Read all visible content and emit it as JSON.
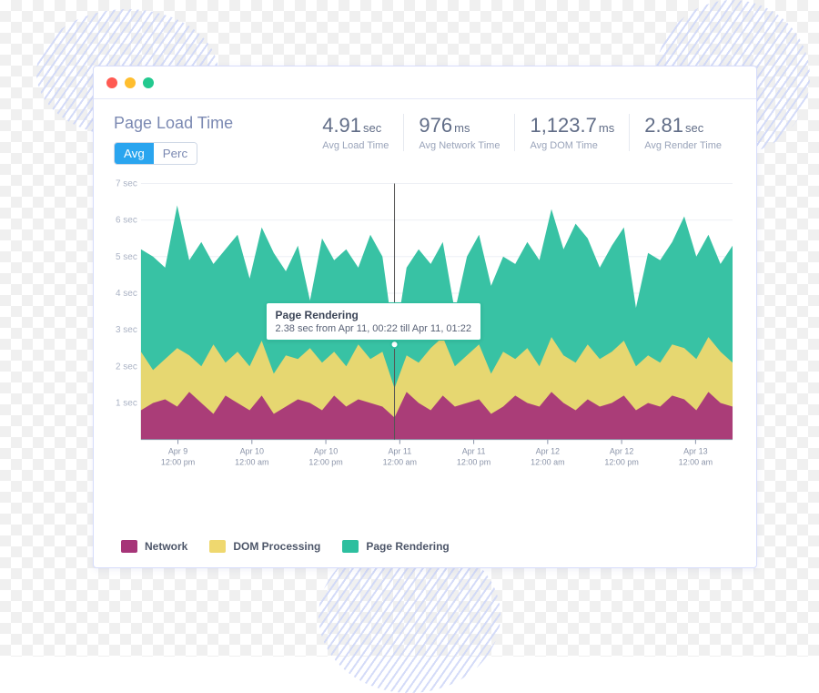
{
  "window": {
    "title": "Page Load Time"
  },
  "toggle": {
    "avg": "Avg",
    "perc": "Perc"
  },
  "metrics": [
    {
      "value": "4.91",
      "unit": "sec",
      "label": "Avg Load Time"
    },
    {
      "value": "976",
      "unit": "ms",
      "label": "Avg Network Time"
    },
    {
      "value": "1,123.7",
      "unit": "ms",
      "label": "Avg DOM Time"
    },
    {
      "value": "2.81",
      "unit": "sec",
      "label": "Avg Render Time"
    }
  ],
  "tooltip": {
    "title": "Page Rendering",
    "body": "2.38 sec from Apr 11, 00:22 till Apr 11, 01:22"
  },
  "legend": [
    {
      "name": "Network",
      "color": "#a63578"
    },
    {
      "name": "DOM Processing",
      "color": "#efd86f"
    },
    {
      "name": "Page Rendering",
      "color": "#2dbf9f"
    }
  ],
  "chart_data": {
    "type": "area",
    "title": "Page Load Time",
    "ylabel": "",
    "xlabel": "",
    "ylim": [
      0,
      7
    ],
    "y_ticks": [
      "1 sec",
      "2 sec",
      "3 sec",
      "4 sec",
      "5 sec",
      "6 sec",
      "7 sec"
    ],
    "x_ticks": [
      "Apr 9\n12:00 pm",
      "Apr 10\n12:00 am",
      "Apr 10\n12:00 pm",
      "Apr 11\n12:00 am",
      "Apr 11\n12:00 pm",
      "Apr 12\n12:00 am",
      "Apr 12\n12:00 pm",
      "Apr 13\n12:00 am"
    ],
    "series": [
      {
        "name": "Network",
        "color": "#a63578",
        "values": [
          0.8,
          1.0,
          1.1,
          0.9,
          1.3,
          1.0,
          0.7,
          1.2,
          1.0,
          0.8,
          1.2,
          0.7,
          0.9,
          1.1,
          1.0,
          0.8,
          1.2,
          0.9,
          1.1,
          1.0,
          0.9,
          0.6,
          1.3,
          1.0,
          0.8,
          1.2,
          0.9,
          1.0,
          1.1,
          0.7,
          0.9,
          1.2,
          1.0,
          0.9,
          1.3,
          1.0,
          0.8,
          1.1,
          0.9,
          1.0,
          1.2,
          0.8,
          1.0,
          0.9,
          1.2,
          1.1,
          0.8,
          1.3,
          1.0,
          0.9
        ]
      },
      {
        "name": "DOM Processing",
        "color": "#efd86f",
        "values": [
          2.4,
          1.9,
          2.2,
          2.5,
          2.3,
          2.0,
          2.6,
          2.1,
          2.4,
          2.0,
          2.7,
          1.8,
          2.3,
          2.2,
          2.5,
          2.1,
          2.4,
          2.0,
          2.6,
          2.2,
          2.4,
          1.4,
          2.3,
          2.1,
          2.5,
          2.8,
          2.0,
          2.3,
          2.6,
          1.8,
          2.4,
          2.2,
          2.5,
          2.0,
          2.8,
          2.3,
          2.1,
          2.6,
          2.2,
          2.4,
          2.7,
          2.0,
          2.3,
          2.1,
          2.6,
          2.5,
          2.2,
          2.8,
          2.4,
          2.1
        ]
      },
      {
        "name": "Page Rendering",
        "color": "#2dbf9f",
        "values": [
          5.2,
          5.0,
          4.7,
          6.4,
          4.9,
          5.4,
          4.8,
          5.2,
          5.6,
          4.4,
          5.8,
          5.1,
          4.6,
          5.3,
          3.8,
          5.5,
          4.9,
          5.2,
          4.7,
          5.6,
          5.0,
          2.6,
          4.7,
          5.2,
          4.8,
          5.4,
          3.5,
          5.0,
          5.6,
          4.2,
          5.0,
          4.8,
          5.4,
          4.9,
          6.3,
          5.2,
          5.9,
          5.5,
          4.7,
          5.3,
          5.8,
          3.6,
          5.1,
          4.9,
          5.4,
          6.1,
          5.0,
          5.6,
          4.8,
          5.3
        ]
      }
    ],
    "crosshair_index": 21,
    "crosshair_series": "Page Rendering",
    "crosshair_value": 2.38
  }
}
